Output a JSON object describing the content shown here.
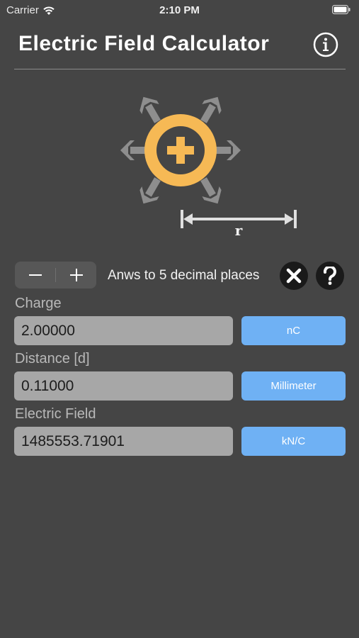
{
  "status_bar": {
    "carrier": "Carrier",
    "time": "2:10 PM"
  },
  "header": {
    "title": "Electric Field Calculator",
    "info_icon": "info-circle-icon"
  },
  "diagram": {
    "distance_label": "r",
    "charge_symbol": "+",
    "charge_color": "#f6b955",
    "arrow_color": "#8e8e8e"
  },
  "controls": {
    "decimal_text": "Anws to 5 decimal places",
    "minus_label": "−",
    "plus_label": "+"
  },
  "fields": {
    "charge": {
      "label": "Charge",
      "value": "2.00000",
      "unit": "nC"
    },
    "distance": {
      "label": "Distance [d]",
      "value": "0.11000",
      "unit": "Millimeter"
    },
    "electric_field": {
      "label": "Electric Field",
      "value": "1485553.71901",
      "unit": "kN/C"
    }
  },
  "colors": {
    "background": "#454545",
    "accent": "#6fb1f4",
    "field_bg": "#a7a7a7"
  }
}
